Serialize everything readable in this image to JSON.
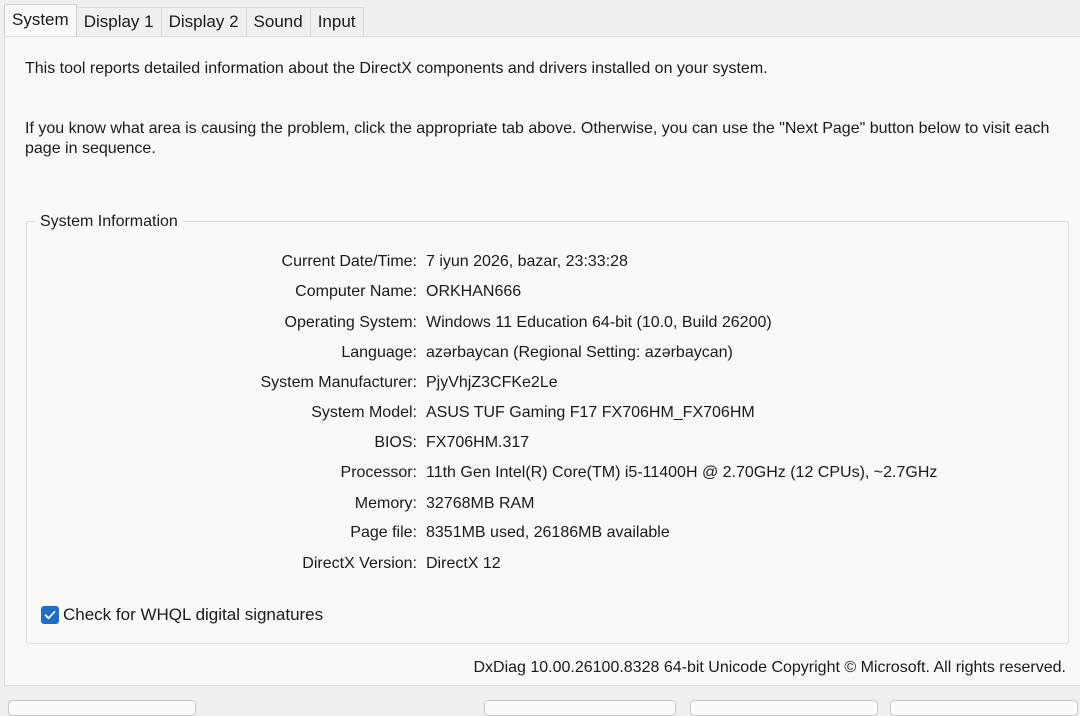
{
  "tabs": [
    {
      "label": "System",
      "active": true
    },
    {
      "label": "Display 1",
      "active": false
    },
    {
      "label": "Display 2",
      "active": false
    },
    {
      "label": "Sound",
      "active": false
    },
    {
      "label": "Input",
      "active": false
    }
  ],
  "intro": {
    "line1": "This tool reports detailed information about the DirectX components and drivers installed on your system.",
    "line2": "If you know what area is causing the problem, click the appropriate tab above.  Otherwise, you can use the \"Next Page\" button below to visit each page in sequence."
  },
  "system_info": {
    "title": "System Information",
    "rows": [
      {
        "label": "Current Date/Time:",
        "value": "7 iyun 2026, bazar, 23:33:28"
      },
      {
        "label": "Computer Name:",
        "value": "ORKHAN666"
      },
      {
        "label": "Operating System:",
        "value": "Windows 11 Education 64-bit (10.0, Build 26200)"
      },
      {
        "label": "Language:",
        "value": "azərbaycan (Regional Setting: azərbaycan)"
      },
      {
        "label": "System Manufacturer:",
        "value": "PjyVhjZ3CFKe2Le"
      },
      {
        "label": "System Model:",
        "value": "ASUS TUF Gaming F17 FX706HM_FX706HM"
      },
      {
        "label": "BIOS:",
        "value": "FX706HM.317"
      },
      {
        "label": "Processor:",
        "value": "11th Gen Intel(R) Core(TM) i5-11400H @ 2.70GHz (12 CPUs), ~2.7GHz"
      },
      {
        "label": "Memory:",
        "value": "32768MB RAM"
      },
      {
        "label": "Page file:",
        "value": "8351MB used, 26186MB available"
      },
      {
        "label": "DirectX Version:",
        "value": "DirectX 12"
      }
    ]
  },
  "whql": {
    "label": "Check for WHQL digital signatures",
    "checked": true
  },
  "footer": "DxDiag 10.00.26100.8328 64-bit Unicode  Copyright © Microsoft. All rights reserved.",
  "colors": {
    "accent": "#1f6fc5",
    "background": "#f0f0f0",
    "panel": "#f9f9f9"
  }
}
